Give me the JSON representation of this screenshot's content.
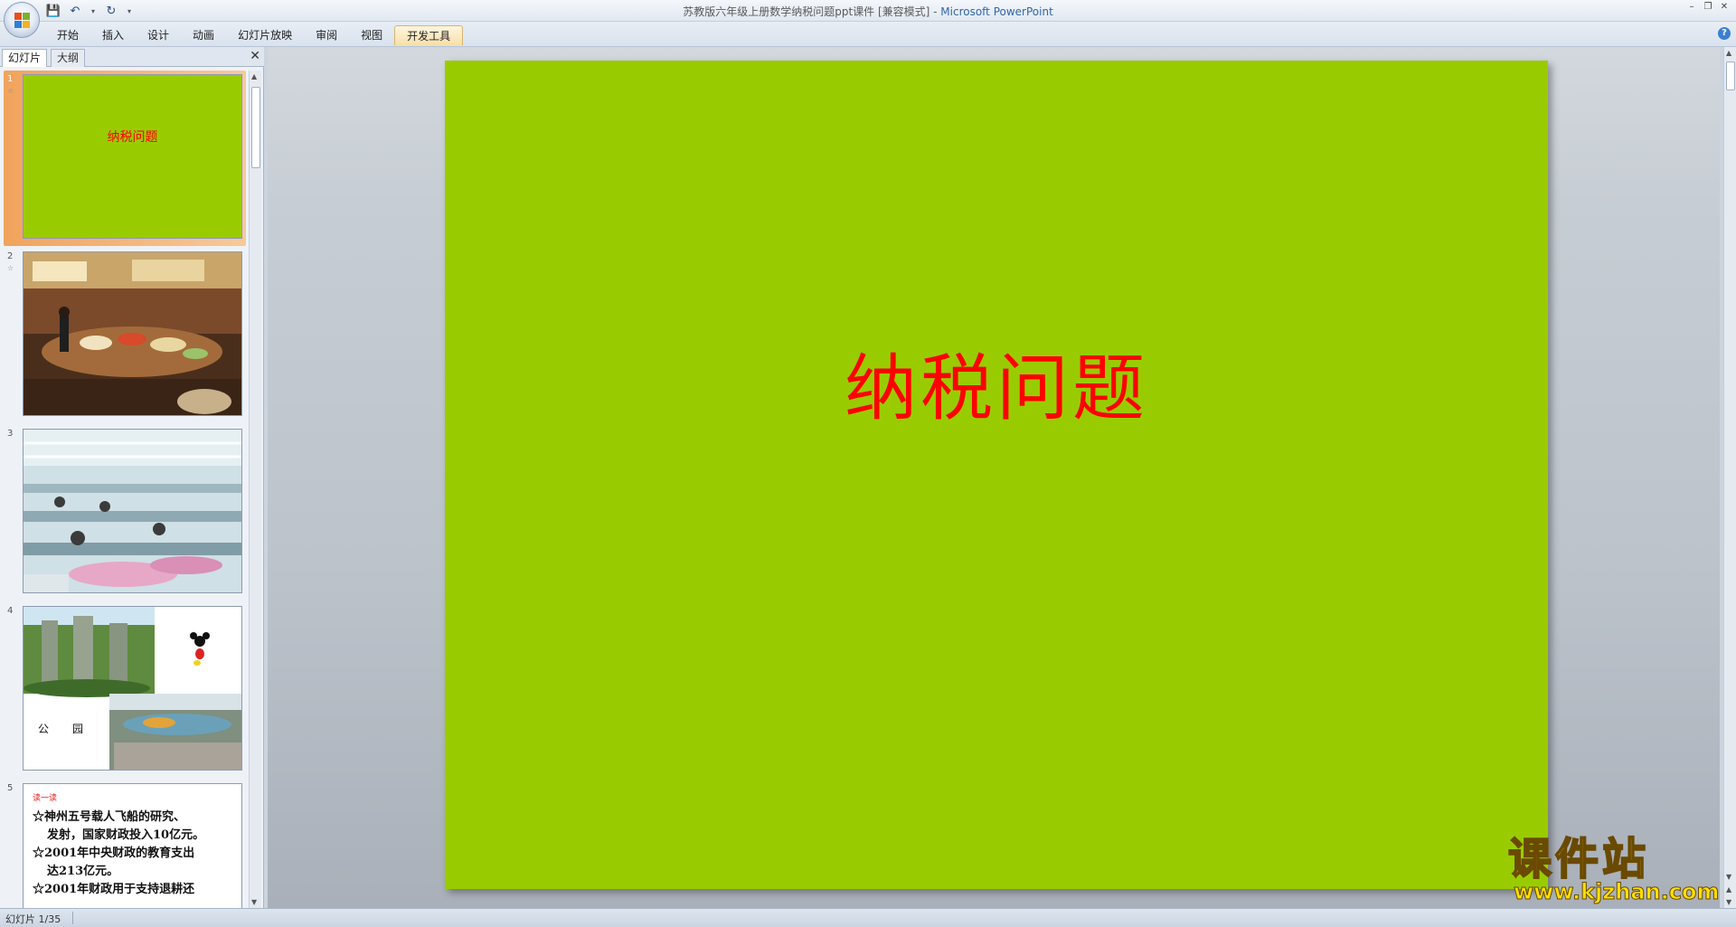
{
  "window": {
    "title_doc": "苏教版六年级上册数学纳税问题ppt课件 [兼容模式] - ",
    "title_app": "Microsoft PowerPoint"
  },
  "ribbon": {
    "tabs": [
      "开始",
      "插入",
      "设计",
      "动画",
      "幻灯片放映",
      "审阅",
      "视图",
      "开发工具"
    ],
    "active_tab": "开发工具"
  },
  "left_pane": {
    "tab_slides": "幻灯片",
    "tab_outline": "大纲",
    "close": "✕",
    "thumbnails": [
      {
        "number": "1",
        "title": "纳税问题",
        "selected": true
      },
      {
        "number": "2",
        "selected": false
      },
      {
        "number": "3",
        "selected": false
      },
      {
        "number": "4",
        "label_a": "公",
        "label_b": "园",
        "selected": false
      },
      {
        "number": "5",
        "header": "读一读",
        "lines": [
          "☆神州五号载人飞船的研究、",
          "发射，国家财政投入10亿元。",
          "☆2001年中央财政的教育支出",
          "达213亿元。",
          "☆2001年财政用于支持退耕还"
        ],
        "selected": false
      }
    ]
  },
  "slide": {
    "title": "纳税问题",
    "background": "#99cc00",
    "title_color": "#ff0000"
  },
  "status": {
    "slide_counter": "幻灯片 1/35"
  },
  "watermark": {
    "cn": "课件站",
    "en": "www.kjzhan.com"
  }
}
